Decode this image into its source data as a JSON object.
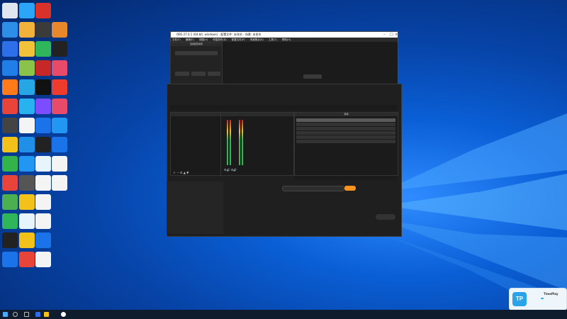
{
  "desktop": {
    "icons": [
      {
        "label": "",
        "color": "#dfe6ee"
      },
      {
        "label": "",
        "color": "#2ba5f7"
      },
      {
        "label": "",
        "color": "#d8322a"
      },
      {
        "label": "",
        "color": "#2d8ee8"
      },
      {
        "label": "",
        "color": "#f0b23b"
      },
      {
        "label": "",
        "color": "#3b3b3b"
      },
      {
        "label": "",
        "color": "#e8882a"
      },
      {
        "label": "",
        "color": "#2d6fe8"
      },
      {
        "label": "",
        "color": "#f3c23b"
      },
      {
        "label": "",
        "color": "#2fb55a"
      },
      {
        "label": "",
        "color": "#222"
      },
      {
        "label": "",
        "color": "#1f7ee8"
      },
      {
        "label": "",
        "color": "#8bc34a"
      },
      {
        "label": "",
        "color": "#c62828"
      },
      {
        "label": "",
        "color": "#e84a6a"
      },
      {
        "label": "",
        "color": "#ff7a1a"
      },
      {
        "label": "",
        "color": "#27a6e5"
      },
      {
        "label": "",
        "color": "#111"
      },
      {
        "label": "",
        "color": "#ef3b2c"
      },
      {
        "label": "",
        "color": "#e8443a"
      },
      {
        "label": "",
        "color": "#28b3f0"
      },
      {
        "label": "",
        "color": "#7c4dff"
      },
      {
        "label": "",
        "color": "#e84a6a"
      },
      {
        "label": "",
        "color": "#444"
      },
      {
        "label": "",
        "color": "#f4f4f4"
      },
      {
        "label": "",
        "color": "#1a73e8"
      },
      {
        "label": "",
        "color": "#2196f3"
      },
      {
        "label": "",
        "color": "#f2c21b"
      },
      {
        "label": "",
        "color": "#1f8fe8"
      },
      {
        "label": "",
        "color": "#222"
      },
      {
        "label": "",
        "color": "#1a73e8"
      },
      {
        "label": "",
        "color": "#32b44a"
      },
      {
        "label": "",
        "color": "#2196f3"
      },
      {
        "label": "",
        "color": "#e8f4fb"
      },
      {
        "label": "",
        "color": "#f4f4f4"
      },
      {
        "label": "",
        "color": "#e8443a"
      },
      {
        "label": "",
        "color": "#555"
      },
      {
        "label": "",
        "color": "#f4f4f4"
      },
      {
        "label": "",
        "color": "#f4f4f4"
      },
      {
        "label": "",
        "color": "#4caf50"
      },
      {
        "label": "",
        "color": "#f2c21b"
      },
      {
        "label": "",
        "color": "#f4f4f4"
      },
      {
        "label": "",
        "color": "#2fb55a"
      },
      {
        "label": "",
        "color": "#e8f4fb"
      },
      {
        "label": "",
        "color": "#f4f4f4"
      },
      {
        "label": "",
        "color": "#222"
      },
      {
        "label": "",
        "color": "#f2c21b"
      },
      {
        "label": "",
        "color": "#1a73e8"
      },
      {
        "label": "",
        "color": "#1a73e8"
      },
      {
        "label": "",
        "color": "#e8443a"
      },
      {
        "label": "",
        "color": "#f4f4f4"
      }
    ]
  },
  "obs": {
    "title": "OBS 27.0.1 (64-bit, windows) - 配置文件: 未命名 - 场景: 未命名",
    "menu": [
      "文件(F)",
      "编辑(E)",
      "视图(V)",
      "停靠部件(D)",
      "配置文件(P)",
      "场景集合(S)",
      "工具(T)",
      "帮助(H)"
    ],
    "dock_title": "自动配置向导",
    "dock_btn": "",
    "dock_text1": "",
    "dock_text2": "",
    "section1": "",
    "section2": "",
    "btn_a": "",
    "btn_b": "",
    "btn_c": "",
    "preview_hint": "",
    "preview_btn": "",
    "studio_label": "",
    "mode_label": "",
    "scenes_header": "",
    "mixer_header": "",
    "transitions_header": "转场",
    "sources": [
      "",
      "",
      ""
    ],
    "transitions": [
      "",
      "",
      "",
      "",
      "",
      ""
    ],
    "status": [
      ""
    ]
  },
  "bottom_app": {
    "left_items": [
      "",
      "",
      "",
      "",
      "",
      ""
    ],
    "url_label": "",
    "url_value": "",
    "go_btn": "",
    "hint": "",
    "tools": [
      "",
      "",
      "",
      "",
      "",
      ""
    ],
    "footer": ""
  },
  "notification": {
    "brand": "TP",
    "name": "TimePlay",
    "sub": ""
  },
  "taskbar": {
    "clock_time": "",
    "clock_date": ""
  }
}
